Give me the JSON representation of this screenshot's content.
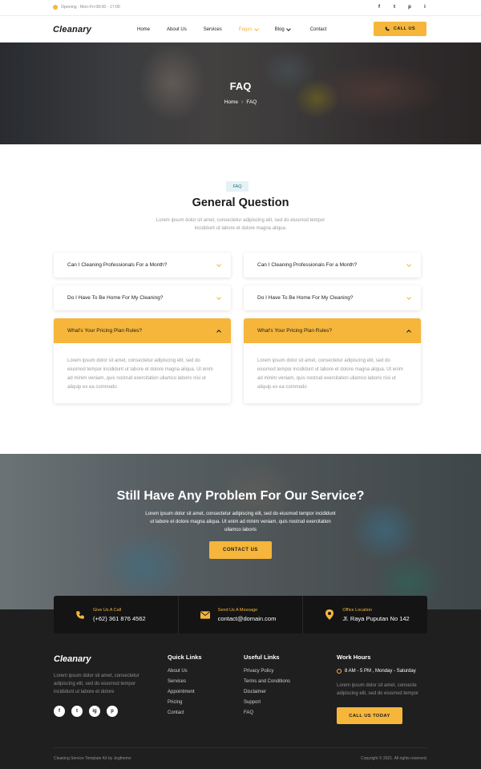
{
  "topbar": {
    "opening": "Opening : Mon-Fri 08:00 - 17:00",
    "socials": [
      "f",
      "t",
      "p",
      "i"
    ]
  },
  "nav": {
    "logo": "Cleanary",
    "items": [
      "Home",
      "About Us",
      "Services",
      "Pages",
      "Blog",
      "Contact"
    ],
    "active_item": "Pages",
    "call_button": "CALL US"
  },
  "hero": {
    "title": "FAQ",
    "breadcrumb": [
      "Home",
      "FAQ"
    ]
  },
  "faq": {
    "badge": "FAQ",
    "title": "General Question",
    "subtitle": "Lorem ipsum dolor sit amet, consectetur adipiscing elit, sed do eiusmod tempor incididunt ut labore et dolore magna aliqua.",
    "left": [
      {
        "question": "Can I Cleaning Professionals For a Month?",
        "open": false
      },
      {
        "question": "Do I Have To Be Home For My Cleaning?",
        "open": false
      },
      {
        "question": "What's Your Pricing Plan Rules?",
        "open": true,
        "answer": "Lorem ipsum dolor sit amet, consectetur adipiscing elit, sed do eiusmod tempor incididunt ut labore et dolore magna aliqua. Ut enim ad minim veniam, quis nostrud exercitation ullamco laboris nisi ut aliquip ex ea commodo"
      }
    ],
    "right": [
      {
        "question": "Can I Cleaning Professionals For a Month?",
        "open": false
      },
      {
        "question": "Do I Have To Be Home For My Cleaning?",
        "open": false
      },
      {
        "question": "What's Your Pricing Plan Rules?",
        "open": true,
        "answer": "Lorem ipsum dolor sit amet, consectetur adipiscing elit, sed do eiusmod tempor incididunt ut labore et dolore magna aliqua. Ut enim ad minim veniam, quis nostrud exercitation ullamco laboris nisi ut aliquip ex ea commodo"
      }
    ]
  },
  "cta": {
    "title": "Still Have Any Problem For Our Service?",
    "text": "Lorem ipsum dolor sit amet, consectetur adipiscing elit, sed do eiusmod tempor incididunt ut labore et dolore magna aliqua. Ut enim ad minim veniam, quis nostrud exercitation ullamco laboris",
    "button": "CONTACT US"
  },
  "contact": [
    {
      "label": "Give Us A Call",
      "value": "(+62) 361 876 4562",
      "icon": "phone-icon"
    },
    {
      "label": "Send Us A Message",
      "value": "contact@domain.com",
      "icon": "mail-icon"
    },
    {
      "label": "Office Location",
      "value": "Jl. Raya Puputan No 142",
      "icon": "location-pin-icon"
    }
  ],
  "footer": {
    "logo": "Cleanary",
    "description": "Lorem ipsum dolor sit amet, consectetur adipiscing elit, sed do eiusmod tempor incididunt ut labore et dolore",
    "socials": [
      "f",
      "t",
      "ig",
      "p"
    ],
    "quick_links": {
      "title": "Quick Links",
      "items": [
        "About Us",
        "Services",
        "Appointment",
        "Pricing",
        "Contact"
      ]
    },
    "useful_links": {
      "title": "Useful Links",
      "items": [
        "Privacy Policy",
        "Terms and Conditions",
        "Disclaimer",
        "Support",
        "FAQ"
      ]
    },
    "work_hours": {
      "title": "Work Hours",
      "hours": "8 AM - 5 PM , Monday - Saturday",
      "description": "Lorem ipsum dolor sit amet, consecte adipiscing elit, sed do eiusmod tempor",
      "button": "CALL US TODAY"
    },
    "bottom_left": "Cleaning Service Template Kit by Jegtheme",
    "bottom_right": "Copyright © 2021. All rights reserved."
  },
  "colors": {
    "accent": "#f5b63b",
    "dark": "#1f1f1f",
    "badge_bg": "#e4f2f5"
  }
}
